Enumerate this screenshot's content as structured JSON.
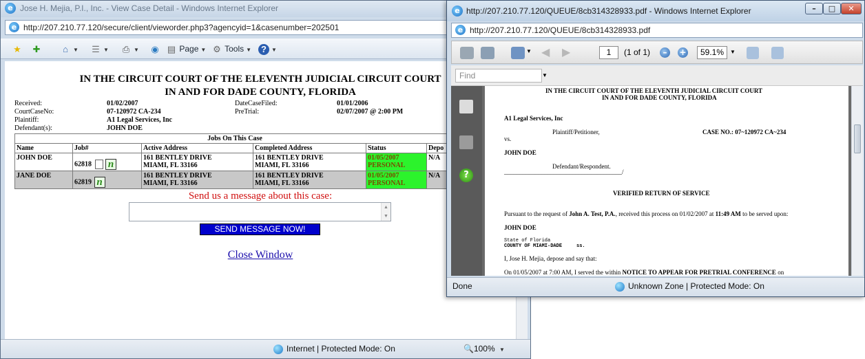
{
  "back_window": {
    "title": "Jose H. Mejia, P.I., Inc. - View Case Detail - Windows Internet Explorer",
    "url": "http://207.210.77.120/secure/client/vieworder.php3?agencyid=1&casenumber=202501",
    "toolbar": {
      "page_label": "Page",
      "tools_label": "Tools"
    },
    "doc": {
      "title1": "IN THE CIRCUIT COURT OF THE ELEVENTH JUDICIAL CIRCUIT COURT",
      "title2": "IN AND FOR DADE COUNTY, FLORIDA",
      "received_label": "Received:",
      "received_value": "01/02/2007",
      "datefiled_label": "DateCaseFiled:",
      "datefiled_value": "01/01/2006",
      "courtcase_label": "CourtCaseNo:",
      "courtcase_value": "07-120972 CA-234",
      "pretrial_label": "PreTrial:",
      "pretrial_value": "02/07/2007 @ 2:00 PM",
      "plaintiff_label": "Plaintiff:",
      "plaintiff_value": "A1 Legal Services, Inc",
      "defendant_label": "Defendant(s):",
      "defendant_value": "JOHN DOE",
      "jobs_caption": "Jobs On This Case",
      "columns": [
        "Name",
        "Job#",
        "Active Address",
        "Completed Address",
        "Status",
        "Depo"
      ],
      "rows": [
        {
          "name": "JOHN DOE",
          "job": "62818",
          "active1": "161 BENTLEY DRIVE",
          "active2": "MIAMI, FL 33166",
          "completed1": "161 BENTLEY DRIVE",
          "completed2": "MIAMI, FL 33166",
          "status1": "01/05/2007",
          "status2": "PERSONAL",
          "depo": "N/A"
        },
        {
          "name": "JANE DOE",
          "job": "62819",
          "active1": "161 BENTLEY DRIVE",
          "active2": "MIAMI, FL 33166",
          "completed1": "161 BENTLEY DRIVE",
          "completed2": "MIAMI, FL 33166",
          "status1": "01/05/2007",
          "status2": "PERSONAL",
          "depo": "N/A"
        }
      ],
      "n_icon": "n",
      "send_label": "Send us a message about this case:",
      "send_button": "SEND MESSAGE NOW!",
      "close_link": "Close Window"
    },
    "status": {
      "zone": "Internet | Protected Mode: On",
      "zoom": "100%"
    }
  },
  "front_window": {
    "title": "http://207.210.77.120/QUEUE/8cb314328933.pdf - Windows Internet Explorer",
    "url": "http://207.210.77.120/QUEUE/8cb314328933.pdf",
    "pdf_toolbar": {
      "page_value": "1",
      "page_count": "(1 of 1)",
      "zoom_value": "59.1%"
    },
    "find_placeholder": "Find",
    "sheet": {
      "l1": "IN THE CIRCUIT COURT OF THE ELEVENTH JUDICIAL CIRCUIT COURT",
      "l2": "IN AND FOR DADE COUNTY, FLORIDA",
      "l3": "A1 Legal Services, Inc",
      "l4": "Plaintiff/Petitioner,",
      "l5": "CASE NO.: 07~120972 CA~234",
      "l6": "vs.",
      "l7": "JOHN DOE",
      "l8": "Defendant/Respondent.",
      "l9": "______________________________________/",
      "l10": "VERIFIED RETURN OF SERVICE",
      "l11a": "Pursuant to the request of ",
      "l11b": "John A. Test, P.A.",
      "l11c": ", received this process on 01/02/2007 at ",
      "l11d": "11:49 AM",
      "l11e": " to be served upon:",
      "l12": "JOHN DOE",
      "l13": "State of Florida",
      "l14": "COUNTY OF MIAMI-DADE     ss.",
      "l15": "I, Jose H. Mejia, depose and say that:",
      "l16a": "On 01/05/2007 at 7:00 AM, I served the within ",
      "l16b": "NOTICE TO APPEAR FOR PRETRIAL CONFERENCE",
      "l16c": " on"
    },
    "status": {
      "done": "Done",
      "zone": "Unknown Zone | Protected Mode: On"
    }
  }
}
